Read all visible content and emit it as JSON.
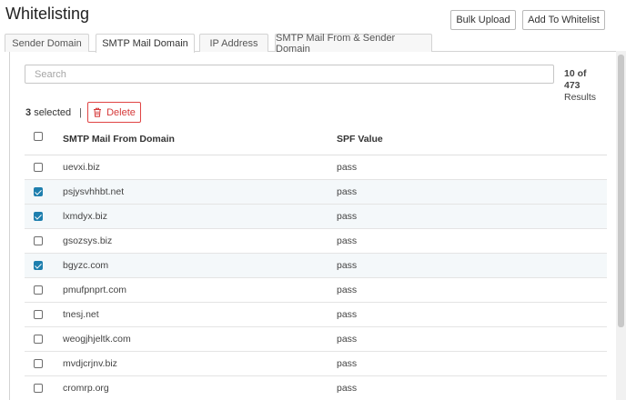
{
  "page": {
    "title": "Whitelisting"
  },
  "header_buttons": {
    "bulk_upload": "Bulk Upload",
    "add_to_whitelist": "Add To Whitelist"
  },
  "tabs": [
    {
      "label": "Sender Domain",
      "active": false
    },
    {
      "label": "SMTP Mail Domain",
      "active": true
    },
    {
      "label": "IP Address",
      "active": false
    },
    {
      "label": "SMTP Mail From & Sender Domain",
      "active": false
    }
  ],
  "search": {
    "placeholder": "Search",
    "value": ""
  },
  "results": {
    "count": "10 of",
    "total": "473",
    "label": "Results"
  },
  "selection": {
    "count": "3",
    "label": "selected",
    "separator": "|"
  },
  "delete_button": {
    "label": "Delete",
    "icon": "trash-icon",
    "color": "#d63a3a"
  },
  "table": {
    "columns": [
      "SMTP Mail From Domain",
      "SPF Value"
    ],
    "rows": [
      {
        "domain": "uevxi.biz",
        "spf": "pass",
        "checked": false
      },
      {
        "domain": "psjysvhhbt.net",
        "spf": "pass",
        "checked": true
      },
      {
        "domain": "lxmdyx.biz",
        "spf": "pass",
        "checked": true
      },
      {
        "domain": "gsozsys.biz",
        "spf": "pass",
        "checked": false
      },
      {
        "domain": "bgyzc.com",
        "spf": "pass",
        "checked": true
      },
      {
        "domain": "pmufpnprt.com",
        "spf": "pass",
        "checked": false
      },
      {
        "domain": "tnesj.net",
        "spf": "pass",
        "checked": false
      },
      {
        "domain": "weogjhjeltk.com",
        "spf": "pass",
        "checked": false
      },
      {
        "domain": "mvdjcrjnv.biz",
        "spf": "pass",
        "checked": false
      },
      {
        "domain": "cromrp.org",
        "spf": "pass",
        "checked": false
      }
    ]
  },
  "colors": {
    "accent": "#1e7fae",
    "danger": "#d63a3a"
  }
}
